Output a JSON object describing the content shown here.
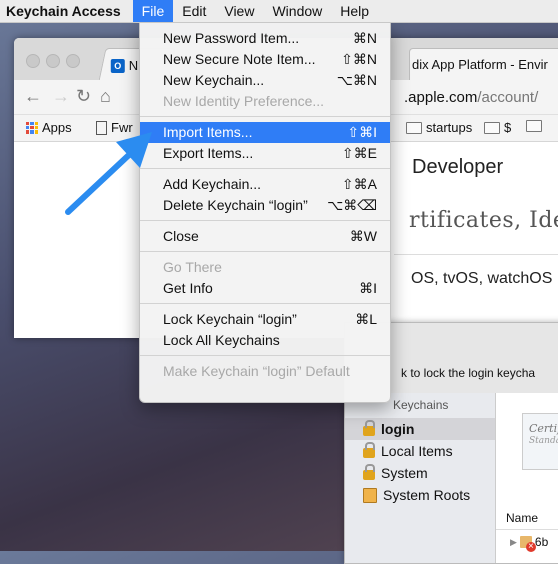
{
  "menubar": {
    "app_name": "Keychain Access",
    "items": [
      "File",
      "Edit",
      "View",
      "Window",
      "Help"
    ]
  },
  "file_menu": {
    "groups": [
      [
        {
          "label": "New Password Item...",
          "shortcut": "⌘N",
          "enabled": true
        },
        {
          "label": "New Secure Note Item...",
          "shortcut": "⇧⌘N",
          "enabled": true
        },
        {
          "label": "New Keychain...",
          "shortcut": "⌥⌘N",
          "enabled": true
        },
        {
          "label": "New Identity Preference...",
          "shortcut": "",
          "enabled": false
        }
      ],
      [
        {
          "label": "Import Items...",
          "shortcut": "⇧⌘I",
          "enabled": true,
          "highlighted": true
        },
        {
          "label": "Export Items...",
          "shortcut": "⇧⌘E",
          "enabled": true
        }
      ],
      [
        {
          "label": "Add Keychain...",
          "shortcut": "⇧⌘A",
          "enabled": true
        },
        {
          "label": "Delete Keychain “login”",
          "shortcut": "⌥⌘⌫",
          "enabled": true
        }
      ],
      [
        {
          "label": "Close",
          "shortcut": "⌘W",
          "enabled": true
        }
      ],
      [
        {
          "label": "Go There",
          "shortcut": "",
          "enabled": false
        },
        {
          "label": "Get Info",
          "shortcut": "⌘I",
          "enabled": true
        }
      ],
      [
        {
          "label": "Lock Keychain “login”",
          "shortcut": "⌘L",
          "enabled": true
        },
        {
          "label": "Lock All Keychains",
          "shortcut": "",
          "enabled": true
        }
      ],
      [
        {
          "label": "Make Keychain “login” Default",
          "shortcut": "",
          "enabled": false
        }
      ]
    ]
  },
  "browser": {
    "tab1_label": "N",
    "tab2_label": "dix App Platform - Envir",
    "url_host": ".apple.com",
    "url_path": "/account/",
    "bookmarks": {
      "apps": "Apps",
      "fw": "Fwr",
      "startups": "startups",
      "dollar": "$"
    },
    "page_developer": "Developer",
    "page_cert_heading": "rtificates, Ident",
    "page_os": "OS, tvOS, watchOS"
  },
  "keychain": {
    "lock_message": "k to lock the login keycha",
    "sidebar_header": "Keychains",
    "items": [
      {
        "label": "login",
        "selected": true,
        "icon": "lock-open-icon"
      },
      {
        "label": "Local Items",
        "selected": false,
        "icon": "lock-open-icon"
      },
      {
        "label": "System",
        "selected": false,
        "icon": "lock-icon"
      },
      {
        "label": "System Roots",
        "selected": false,
        "icon": "cabinet-icon"
      }
    ],
    "cert_thumb_line1": "Certifi",
    "cert_thumb_line2": "Standard",
    "column_name": "Name",
    "row_label": "6b"
  },
  "colors": {
    "highlight": "#2f7df6",
    "arrow": "#2b8cf0"
  }
}
